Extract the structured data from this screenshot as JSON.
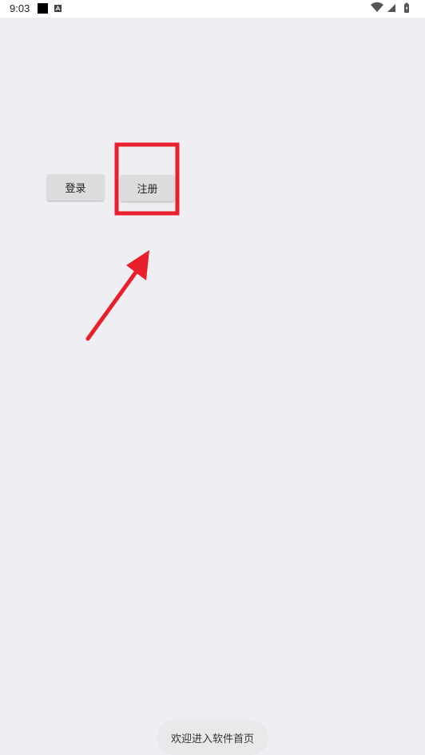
{
  "status_bar": {
    "time": "9:03",
    "icons": [
      "notification-square-icon",
      "a-notification-icon",
      "wifi-icon",
      "signal-icon",
      "battery-icon"
    ]
  },
  "buttons": {
    "login_label": "登录",
    "register_label": "注册"
  },
  "toast": {
    "message": "欢迎进入软件首页"
  },
  "annotation": {
    "highlight_color": "#e8202b",
    "arrow_color": "#e8202b"
  },
  "colors": {
    "background": "#efeef3",
    "button": "#dcdcdc"
  }
}
